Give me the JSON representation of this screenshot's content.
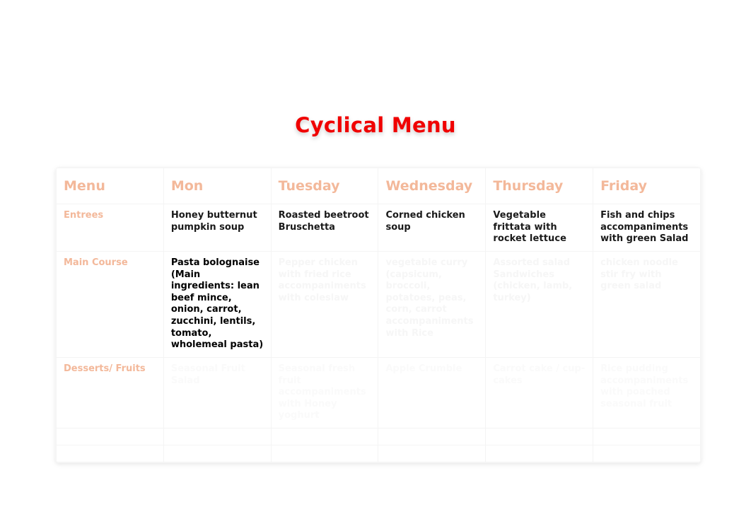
{
  "title": "Cyclical Menu",
  "headers": [
    "Menu",
    "Mon",
    "Tuesday",
    "Wednesday",
    "Thursday",
    "Friday"
  ],
  "rows": [
    {
      "label": "Entrees",
      "cells": [
        "Honey butternut pumpkin soup",
        "Roasted beetroot Bruschetta",
        "Corned  chicken soup",
        "Vegetable frittata with rocket lettuce",
        "Fish and chips accompaniments with green Salad"
      ]
    },
    {
      "label": "Main Course",
      "cells": [
        "Pasta bolognaise (Main ingredients: lean beef mince, onion, carrot, zucchini, lentils, tomato, wholemeal pasta)",
        "Pepper  chicken with fried rice accompaniments with coleslaw",
        "vegetable curry (capsicum, broccoli, potatoes, peas, corn, carrot accompaniments with Rice",
        "Assorted salad Sandwiches  (chicken, lamb, turkey)",
        "chicken noodle stir fry with green salad",
        ""
      ]
    },
    {
      "label": "Desserts/ Fruits",
      "cells": [
        "Seasonal Fruit Salad",
        "Seasonal fresh fruit accompaniments with Honey yoghurt",
        "Apple Crumble",
        "Carrot cake / cup-cakes",
        "Rice pudding accompaniments with poached seasonal fruit"
      ]
    },
    {
      "label": "",
      "cells": [
        "",
        "",
        "",
        "",
        ""
      ]
    },
    {
      "label": "",
      "cells": [
        "",
        "",
        "",
        "",
        ""
      ]
    }
  ],
  "chart_data": {
    "type": "table",
    "title": "Cyclical Menu",
    "columns": [
      "Menu",
      "Mon",
      "Tuesday",
      "Wednesday",
      "Thursday",
      "Friday"
    ],
    "rows": [
      [
        "Entrees",
        "Honey butternut pumpkin soup",
        "Roasted beetroot Bruschetta",
        "Corned  chicken soup",
        "Vegetable frittata with rocket lettuce",
        "Fish and chips accompaniments with green Salad"
      ],
      [
        "Main Course",
        "Pasta bolognaise (Main ingredients: lean beef mince, onion, carrot, zucchini, lentils, tomato, wholemeal pasta)",
        "Pepper  chicken with fried rice accompaniments with coleslaw",
        "vegetable curry (capsicum, broccoli, potatoes, peas, corn, carrot accompaniments with Rice",
        "Assorted salad Sandwiches  (chicken, lamb, turkey)",
        "chicken noodle stir fry with green salad"
      ],
      [
        "Desserts/ Fruits",
        "Seasonal Fruit Salad",
        "Seasonal fresh fruit accompaniments with Honey yoghurt",
        "Apple Crumble",
        "Carrot cake / cup-cakes",
        "Rice pudding accompaniments with poached seasonal fruit"
      ],
      [
        "",
        "",
        "",
        "",
        "",
        ""
      ],
      [
        "",
        "",
        "",
        "",
        "",
        ""
      ]
    ]
  }
}
